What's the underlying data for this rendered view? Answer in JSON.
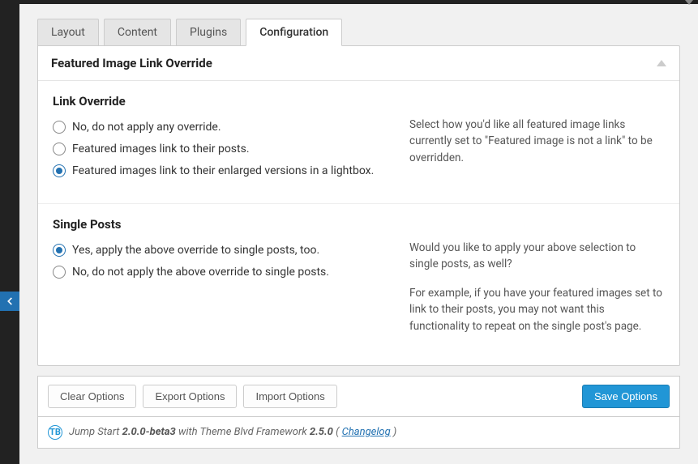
{
  "tabs": {
    "layout": "Layout",
    "content": "Content",
    "plugins": "Plugins",
    "configuration": "Configuration"
  },
  "panel": {
    "title": "Featured Image Link Override"
  },
  "link_override": {
    "heading": "Link Override",
    "options": {
      "none": "No, do not apply any override.",
      "posts": "Featured images link to their posts.",
      "lightbox": "Featured images link to their enlarged versions in a lightbox."
    },
    "help": "Select how you'd like all featured image links currently set to \"Featured image is not a link\" to be overridden."
  },
  "single_posts": {
    "heading": "Single Posts",
    "options": {
      "yes": "Yes, apply the above override to single posts, too.",
      "no": "No, do not apply the above override to single posts."
    },
    "help_1": "Would you like to apply your above selection to single posts, as well?",
    "help_2": "For example, if you have your featured images set to link to their posts, you may not want this functionality to repeat on the single post's page."
  },
  "buttons": {
    "clear": "Clear Options",
    "export": "Export Options",
    "import": "Import Options",
    "save": "Save Options"
  },
  "footer": {
    "intro": "Jump Start",
    "version": "2.0.0-beta3",
    "with": "with Theme Blvd Framework",
    "fw_version": "2.5.0",
    "open_paren": "(",
    "changelog": "Changelog",
    "close_paren": ")"
  }
}
